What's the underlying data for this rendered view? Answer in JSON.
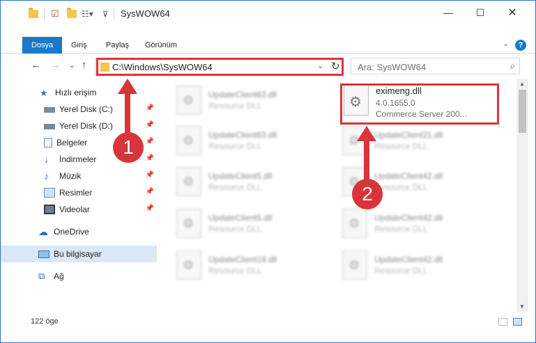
{
  "window": {
    "title": "SysWOW64",
    "minimize_icon": "minimize-icon",
    "maximize_icon": "maximize-icon",
    "close_icon": "close-icon"
  },
  "ribbon": {
    "tabs": [
      "Dosya",
      "Giriş",
      "Paylaş",
      "Görünüm"
    ]
  },
  "navigation": {
    "address": "C:\\Windows\\SysWOW64",
    "search_placeholder": "Ara: SysWOW64"
  },
  "sidebar": {
    "items": [
      {
        "label": "Hızlı erişim",
        "icon": "star-icon",
        "pinned": false
      },
      {
        "label": "Yerel Disk (C:)",
        "icon": "drive-icon",
        "pinned": true
      },
      {
        "label": "Yerel Disk (D:)",
        "icon": "drive-icon",
        "pinned": true
      },
      {
        "label": "Belgeler",
        "icon": "document-icon",
        "pinned": true
      },
      {
        "label": "İndirmeler",
        "icon": "download-icon",
        "pinned": true
      },
      {
        "label": "Müzik",
        "icon": "music-icon",
        "pinned": true
      },
      {
        "label": "Resimler",
        "icon": "pictures-icon",
        "pinned": true
      },
      {
        "label": "Videolar",
        "icon": "video-icon",
        "pinned": true
      },
      {
        "label": "OneDrive",
        "icon": "cloud-icon",
        "pinned": false
      },
      {
        "label": "Bu bilgisayar",
        "icon": "computer-icon",
        "pinned": false,
        "selected": true
      },
      {
        "label": "Ağ",
        "icon": "network-icon",
        "pinned": false
      }
    ]
  },
  "files": {
    "left_column": [
      {
        "name": "UpdateClient63.dll",
        "desc": "Resource DLL"
      },
      {
        "name": "UpdateClient63.dll",
        "desc": "Resource DLL"
      },
      {
        "name": "UpdateClient5.dll",
        "desc": "Resource DLL"
      },
      {
        "name": "UpdateClient5.dll",
        "desc": "Resource DLL"
      },
      {
        "name": "UpdateClient19.dll",
        "desc": "Resource DLL"
      }
    ],
    "right_column": [
      {
        "name": "UpdateClient21.dll",
        "desc": "Resource DLL"
      },
      {
        "name": "UpdateClient42.dll",
        "desc": "Resource DLL"
      },
      {
        "name": "UpdateClient42.dll",
        "desc": "Resource DLL"
      },
      {
        "name": "UpdateClient42.dll",
        "desc": "Resource DLL"
      }
    ],
    "highlighted": {
      "name": "eximeng.dll",
      "version": "4.0.1655.0",
      "desc": "Commerce Server 200..."
    }
  },
  "status": {
    "item_count": "122 öge"
  },
  "annotations": {
    "step1": "1",
    "step2": "2",
    "color": "#d9343a"
  }
}
